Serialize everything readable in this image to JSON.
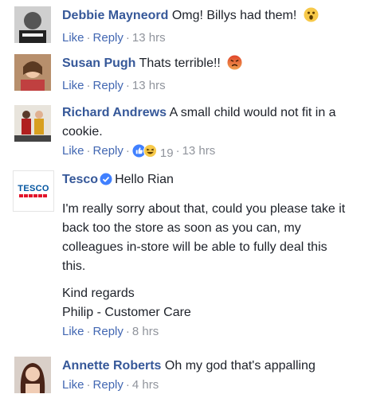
{
  "actions": {
    "like": "Like",
    "reply": "Reply",
    "sep": "·"
  },
  "colors": {
    "name": "#365899",
    "link": "#4267b2",
    "meta": "#90949c",
    "tesco_red": "#e3152b",
    "tesco_blue": "#00539f"
  },
  "comments": [
    {
      "name": "Debbie Mayneord",
      "text": "Omg! Billys had them!",
      "time": "13 hrs",
      "emoji": "surprised-emoji"
    },
    {
      "name": "Susan Pugh",
      "text": "Thats terrible!!",
      "time": "13 hrs",
      "emoji": "angry-emoji"
    },
    {
      "name": "Richard Andrews",
      "text": "A small child would not fit in a",
      "text2": "cookie.",
      "time": "13 hrs",
      "reaction_count": "19"
    },
    {
      "name": "Tesco",
      "text": "Hello Rian",
      "paragraph": [
        "I'm really sorry about that, could you please take it",
        "back too the store as soon as you can, my",
        "colleagues in-store will be able to fully deal this",
        "this."
      ],
      "signoff": [
        "Kind regards",
        "Philip - Customer Care"
      ],
      "time": "8 hrs",
      "logo_text": "TESCO"
    },
    {
      "name": "Annette Roberts",
      "text": "Oh my god that's appalling",
      "time": "4 hrs"
    }
  ]
}
